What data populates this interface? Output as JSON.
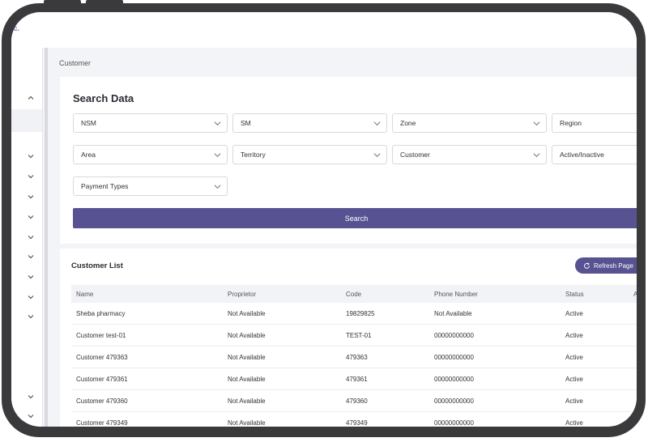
{
  "logo": {
    "fragment": ".c."
  },
  "breadcrumb": "Customer",
  "search": {
    "title": "Search Data",
    "filters": [
      "NSM",
      "SM",
      "Zone",
      "Region",
      "Area",
      "Territory",
      "Customer",
      "Active/Inactive",
      "Payment Types"
    ],
    "button_label": "Search"
  },
  "customer_list": {
    "title": "Customer List",
    "refresh_label": "Refresh Page",
    "columns": [
      "Name",
      "Proprietor",
      "Code",
      "Phone Number",
      "Status",
      "A"
    ],
    "rows": [
      [
        "Sheba pharmacy",
        "Not Available",
        "19829825",
        "Not Available",
        "Active"
      ],
      [
        "Customer test-01",
        "Not Available",
        "TEST-01",
        "00000000000",
        "Active"
      ],
      [
        "Customer 479363",
        "Not Available",
        "479363",
        "00000000000",
        "Active"
      ],
      [
        "Customer 479361",
        "Not Available",
        "479361",
        "00000000000",
        "Active"
      ],
      [
        "Customer 479360",
        "Not Available",
        "479360",
        "00000000000",
        "Active"
      ],
      [
        "Customer 479349",
        "Not Available",
        "479349",
        "00000000000",
        "Active"
      ]
    ]
  },
  "colors": {
    "accent": "#575291",
    "frame": "#3a3a3c",
    "background": "#f3f4f7"
  },
  "icons": {
    "sidebar": "chevron-down-icon",
    "sidebar_open": "chevron-up-icon",
    "select": "chevron-down-icon",
    "refresh": "refresh-icon"
  }
}
